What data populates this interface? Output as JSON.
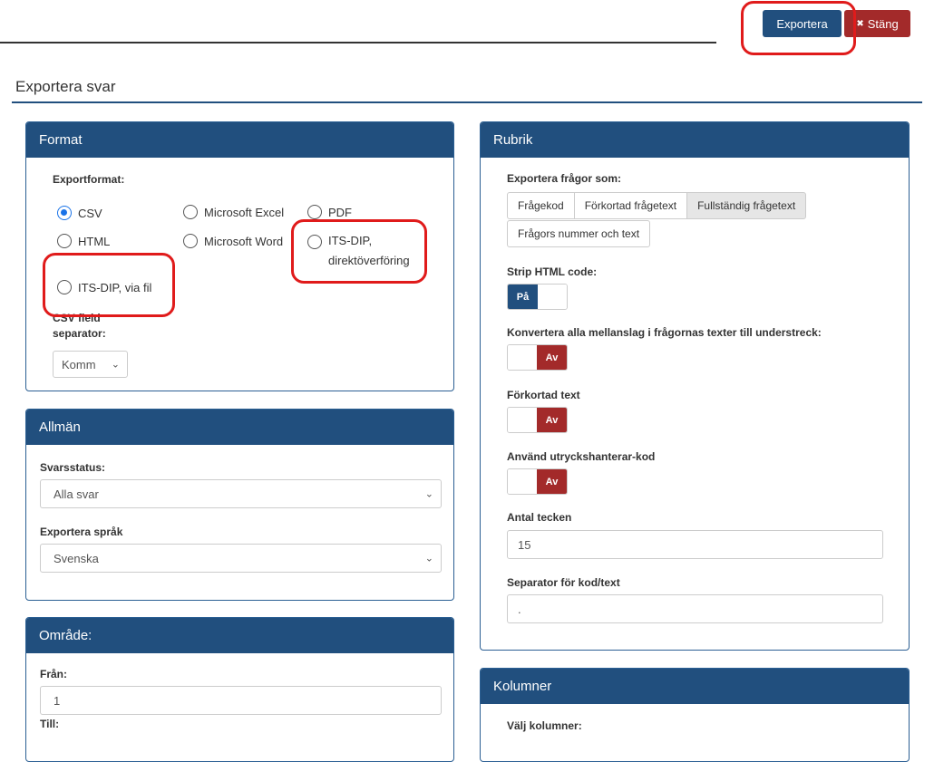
{
  "toolbar": {
    "export_label": "Exportera",
    "close_label": "Stäng",
    "close_icon": "✖"
  },
  "page": {
    "title": "Exportera svar"
  },
  "format": {
    "title": "Format",
    "exportformat_label": "Exportformat:",
    "options": [
      {
        "label": "CSV",
        "selected": true
      },
      {
        "label": "Microsoft Excel",
        "selected": false
      },
      {
        "label": "PDF",
        "selected": false
      },
      {
        "label": "HTML",
        "selected": false
      },
      {
        "label": "Microsoft Word",
        "selected": false
      },
      {
        "label": "ITS-DIP,",
        "selected": false
      },
      {
        "label": "direktöverföring",
        "selected": false
      },
      {
        "label": "ITS-DIP, via fil",
        "selected": false
      }
    ],
    "csv_sep_label_1": "CSV field",
    "csv_sep_label_2": "separator:",
    "csv_sep_value": "Komm"
  },
  "allman": {
    "title": "Allmän",
    "svarsstatus_label": "Svarsstatus:",
    "svarsstatus_value": "Alla svar",
    "sprak_label": "Exportera språk",
    "sprak_value": "Svenska"
  },
  "omrade": {
    "title": "Område:",
    "fran_label": "Från:",
    "fran_value": "1",
    "till_label": "Till:"
  },
  "rubrik": {
    "title": "Rubrik",
    "fragor_label": "Exportera frågor som:",
    "seg1": [
      "Frågekod",
      "Förkortad frågetext",
      "Fullständig frågetext"
    ],
    "seg2": "Frågors nummer och text",
    "strip_label": "Strip HTML code:",
    "strip_state": "På",
    "konvertera_label": "Konvertera alla mellanslag i frågornas texter till understreck:",
    "konvertera_state": "Av",
    "forkortad_label": "Förkortad text",
    "forkortad_state": "Av",
    "utryck_label": "Använd utryckshanterar-kod",
    "utryck_state": "Av",
    "antal_label": "Antal tecken",
    "antal_value": "15",
    "separator_label": "Separator för kod/text",
    "separator_value": "."
  },
  "kolumner": {
    "title": "Kolumner",
    "valj_label": "Välj kolumner:"
  },
  "colors": {
    "primary": "#214f7e",
    "danger": "#a32a2a",
    "highlight": "#e01b1b"
  }
}
